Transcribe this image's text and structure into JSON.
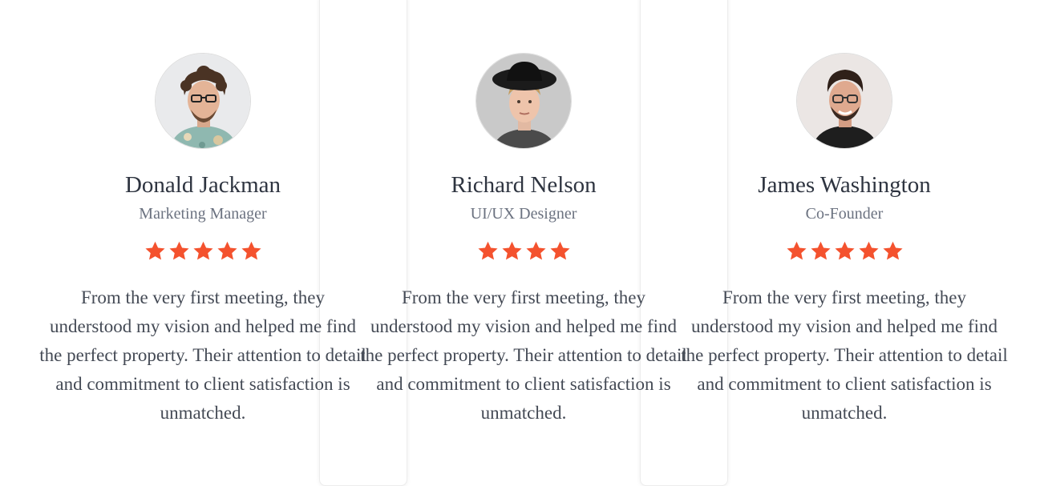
{
  "colors": {
    "star": "#f4522e",
    "name_text": "#2e3440",
    "role_text": "#6b7280",
    "quote_text": "#444a55"
  },
  "testimonials": [
    {
      "name": "Donald Jackman",
      "role": "Marketing Manager",
      "rating": 5,
      "quote": "From the very first meeting, they understood my vision and helped me find the perfect property. Their attention to detail and commitment to client satisfaction is unmatched.",
      "avatar_icon": "avatar-photo-curly-hair-glasses"
    },
    {
      "name": "Richard Nelson",
      "role": "UI/UX Designer",
      "rating": 4,
      "quote": "From the very first meeting, they understood my vision and helped me find the perfect property. Their attention to detail and commitment to client satisfaction is unmatched.",
      "avatar_icon": "avatar-photo-black-hat"
    },
    {
      "name": "James Washington",
      "role": "Co-Founder",
      "rating": 5,
      "quote": "From the very first meeting, they understood my vision and helped me find the perfect property. Their attention to detail and commitment to client satisfaction is unmatched.",
      "avatar_icon": "avatar-photo-glasses-beard"
    }
  ]
}
